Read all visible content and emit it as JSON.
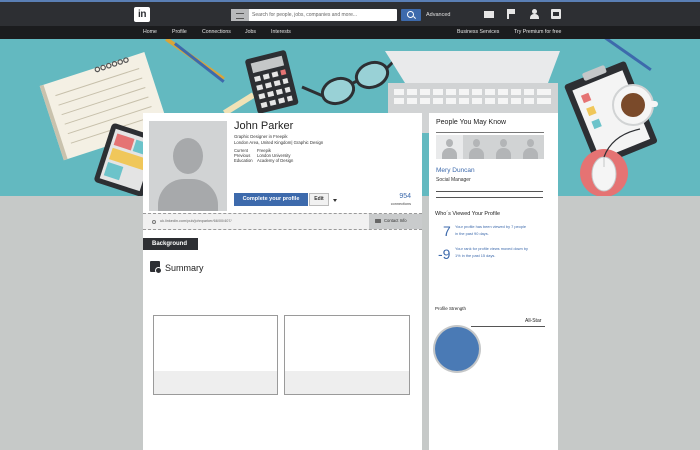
{
  "colors": {
    "brand": "#3d6aac",
    "topbar": "#2d2f33",
    "hero": "#63b9c0",
    "page_background": "#c6c9c8"
  },
  "topbar": {
    "logo_text": "in",
    "search_placeholder": "Search for people, jobs, companies and more...",
    "advanced_label": "Advanced",
    "icons": [
      "search-category-icon",
      "search-icon",
      "mail-icon",
      "flag-icon",
      "add-user-icon",
      "settings-icon"
    ]
  },
  "nav": {
    "items": [
      "Home",
      "Profile",
      "Connections",
      "Jobs",
      "Interests"
    ],
    "business_services": "Business Services",
    "premium": "Try Premium for free"
  },
  "profile": {
    "name": "John Parker",
    "headline": "Graphic Designer in Freepik",
    "location": "London Area, United Kingdom| Graphic Design",
    "details": [
      {
        "label": "Current",
        "value": "Freepik"
      },
      {
        "label": "Previous",
        "value": "London University"
      },
      {
        "label": "Education",
        "value": "Academy of Design"
      }
    ],
    "complete_button": "Complete your profile",
    "edit_button": "Edit",
    "connections_count": "954",
    "connections_label": "connections",
    "public_url": "uk.linkedin.com/pub/johnparker/66/00/407/",
    "contact_info": "Contact Info"
  },
  "sections": {
    "background": "Background",
    "summary": "Summary"
  },
  "sidebar": {
    "pymk_title": "People You May Know",
    "pymk_person": {
      "name": "Mery Duncan",
      "role": "Social Manager"
    },
    "wvp_title": "Who´s Viewed Your Profile",
    "wvp_items": [
      {
        "number": "7",
        "text": "Your profile has been viewed by 7 people in the past 90 days."
      },
      {
        "number": "-9",
        "text": "Your rank for profile views moved down by 1% in the past 15 days."
      }
    ],
    "strength_title": "Profile Strength",
    "strength_level": "All-Star"
  }
}
